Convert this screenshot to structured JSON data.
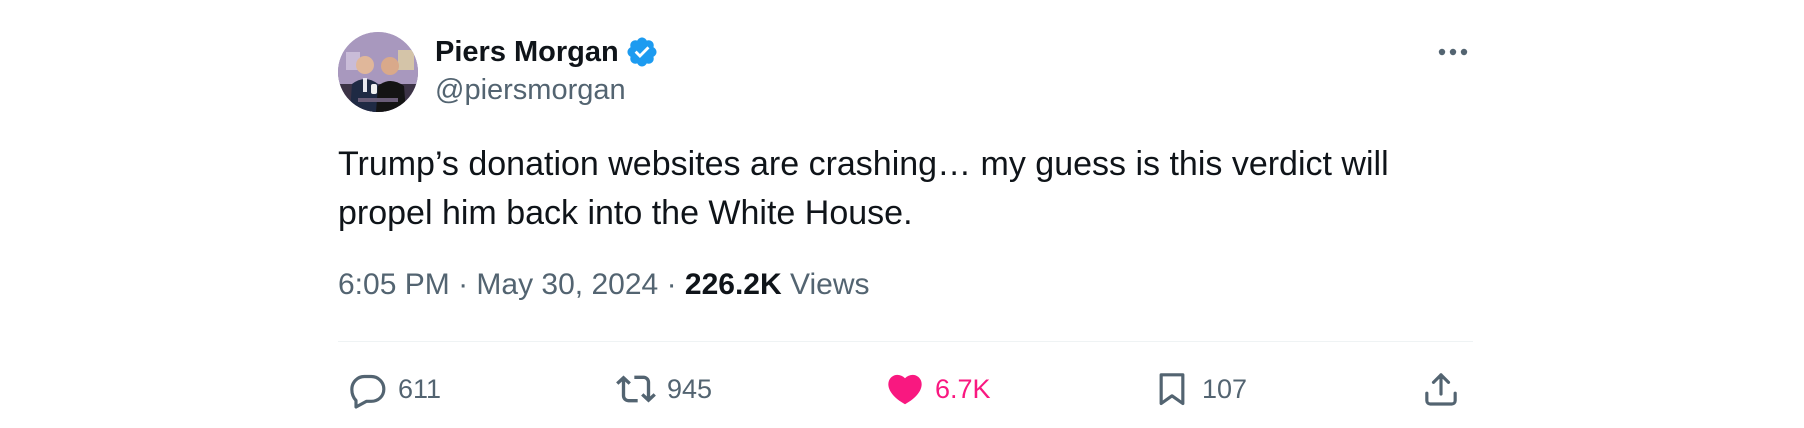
{
  "author": {
    "name": "Piers Morgan",
    "handle": "@piersmorgan",
    "verified": true
  },
  "tweet": {
    "text": "Trump’s donation websites are crashing… my guess is this verdict will propel him back into the White House.",
    "time": "6:05 PM",
    "date": "May 30, 2024",
    "separator": "·",
    "views_count": "226.2K",
    "views_label": "Views"
  },
  "actions": {
    "replies": "611",
    "reposts": "945",
    "likes": "6.7K",
    "bookmarks": "107"
  },
  "icons": {
    "more": "more-icon",
    "reply": "reply-icon",
    "repost": "repost-icon",
    "like": "heart-icon",
    "bookmark": "bookmark-icon",
    "share": "share-icon",
    "verified": "verified-badge-icon"
  },
  "colors": {
    "like_active": "#f91880",
    "verified": "#1d9bf0",
    "secondary_text": "#536471"
  }
}
